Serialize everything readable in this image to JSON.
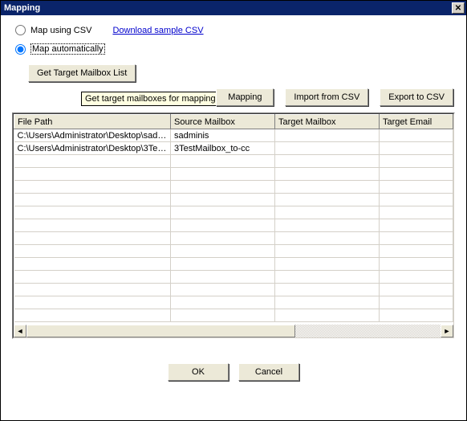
{
  "window": {
    "title": "Mapping"
  },
  "options": {
    "csv_label": "Map using CSV",
    "download_link": "Download sample CSV",
    "auto_label": "Map automatically",
    "selected": "auto"
  },
  "buttons": {
    "get_target_list": "Get Target Mailbox List",
    "tooltip": "Get target mailboxes for mapping",
    "mapping": "Mapping",
    "import_csv": "Import from CSV",
    "export_csv": "Export to CSV",
    "ok": "OK",
    "cancel": "Cancel"
  },
  "table": {
    "columns": [
      "File Path",
      "Source Mailbox",
      "Target Mailbox",
      "Target Email"
    ],
    "rows": [
      {
        "file_path": "C:\\Users\\Administrator\\Desktop\\sadm...",
        "source_mailbox": "sadminis",
        "target_mailbox": "",
        "target_email": ""
      },
      {
        "file_path": "C:\\Users\\Administrator\\Desktop\\3Tes...",
        "source_mailbox": "3TestMailbox_to-cc",
        "target_mailbox": "",
        "target_email": ""
      }
    ],
    "empty_rows": 13
  }
}
